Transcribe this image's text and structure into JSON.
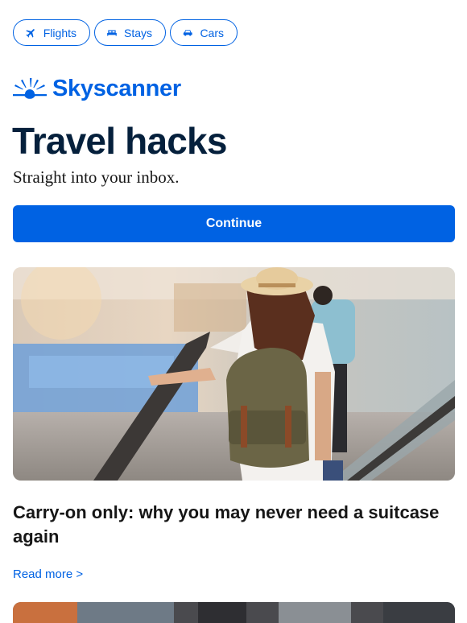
{
  "tabs": [
    {
      "label": "Flights",
      "icon": "plane-icon"
    },
    {
      "label": "Stays",
      "icon": "bed-icon"
    },
    {
      "label": "Cars",
      "icon": "car-icon"
    }
  ],
  "brand": {
    "name": "Skyscanner",
    "color": "#0062e3"
  },
  "hero": {
    "headline": "Travel hacks",
    "subheadline": "Straight into your inbox."
  },
  "cta": {
    "label": "Continue"
  },
  "article": {
    "title": "Carry-on only: why you may never need a suitcase again",
    "link_label": "Read more >"
  },
  "colors": {
    "accent": "#0062e3",
    "heading": "#05203c"
  }
}
